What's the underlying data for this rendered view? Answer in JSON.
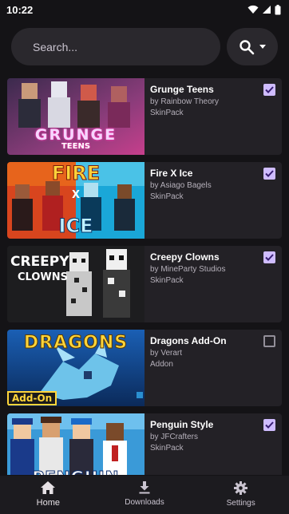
{
  "status": {
    "time": "10:22"
  },
  "search": {
    "placeholder": "Search..."
  },
  "items": [
    {
      "title": "Grunge Teens",
      "author": "by Rainbow Theory",
      "type": "SkinPack",
      "checked": true,
      "thumb_text": "GRUNGE",
      "thumb_sub": "TEENS"
    },
    {
      "title": "Fire X Ice",
      "author": "by Asiago Bagels",
      "type": "SkinPack",
      "checked": true,
      "thumb_text": "FIRE",
      "thumb_mid": "X",
      "thumb_sub": "ICE"
    },
    {
      "title": "Creepy Clowns",
      "author": "by MineParty Studios",
      "type": "SkinPack",
      "checked": true,
      "thumb_text": "CREEPY",
      "thumb_sub": "CLOWNS"
    },
    {
      "title": "Dragons Add-On",
      "author": "by Verart",
      "type": "Addon",
      "checked": false,
      "thumb_text": "DRAGONS",
      "thumb_sub": "Add-On"
    },
    {
      "title": "Penguin Style",
      "author": "by JFCrafters",
      "type": "SkinPack",
      "checked": true,
      "thumb_text": "PENGUIN"
    }
  ],
  "nav": [
    {
      "label": "Home",
      "icon": "home-icon"
    },
    {
      "label": "Downloads",
      "icon": "download-icon"
    },
    {
      "label": "Settings",
      "icon": "gear-icon"
    }
  ],
  "colors": {
    "background": "#141316",
    "card": "#232126",
    "accent": "#cfbcff",
    "surface": "#2a282d"
  }
}
